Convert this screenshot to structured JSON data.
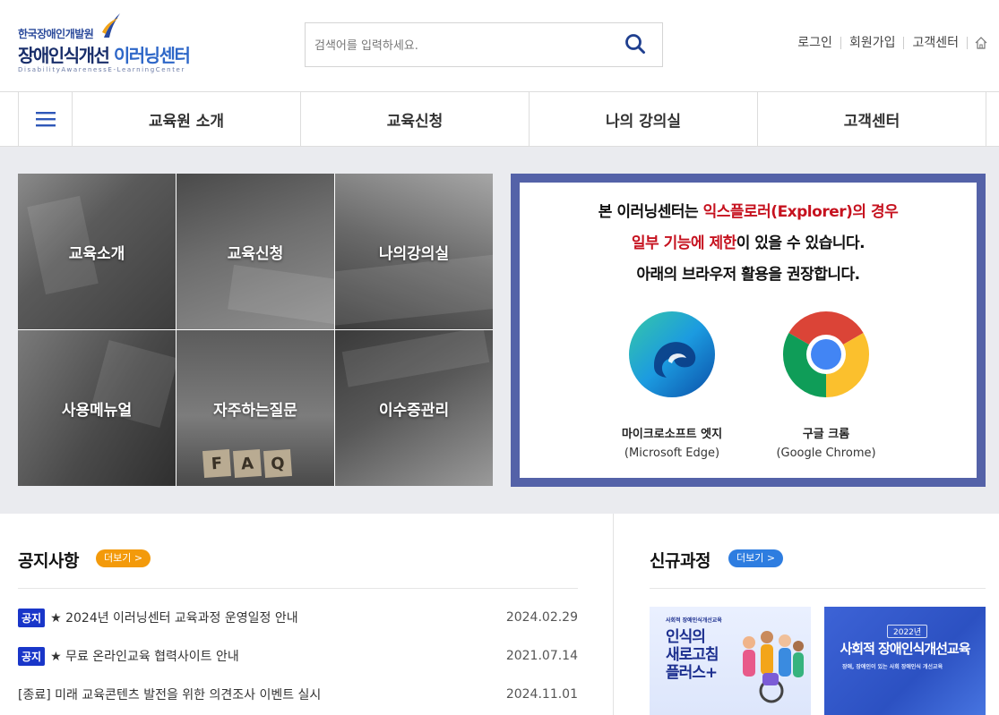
{
  "header": {
    "org_name": "한국장애인개발원",
    "site_name_part1": "장애인식개선 ",
    "site_name_part2": "이러닝센터",
    "site_name_eng": "DisabilityAwarenessE-LearningCenter",
    "search_placeholder": "검색어를 입력하세요.",
    "util_links": [
      "로그인",
      "회원가입",
      "고객센터"
    ],
    "accent_color": "#2e67c8"
  },
  "nav": {
    "menu_icon": "hamburger-menu-icon",
    "items": [
      "교육원 소개",
      "교육신청",
      "나의 강의실",
      "고객센터"
    ]
  },
  "tiles": [
    "교육소개",
    "교육신청",
    "나의강의실",
    "사용메뉴얼",
    "자주하는질문",
    "이수증관리"
  ],
  "faq_letters": [
    "F",
    "A",
    "Q"
  ],
  "browser_notice": {
    "line1_prefix": "본 이러닝센터는 ",
    "line1_red": "익스플로러(Explorer)의 경우",
    "line2_red": "일부 기능에 제한",
    "line2_suffix": "이 있을 수 있습니다.",
    "line3": "아래의 브라우저 활용을 권장합니다.",
    "browsers": [
      {
        "name": "마이크로소프트 엣지",
        "eng": "(Microsoft Edge)",
        "icon": "edge-icon"
      },
      {
        "name": "구글 크롬",
        "eng": "(Google Chrome)",
        "icon": "chrome-icon"
      }
    ],
    "border_color": "#5462a8",
    "highlight_color": "#c6121f"
  },
  "notices": {
    "title": "공지사항",
    "more_label": "더보기 >",
    "items": [
      {
        "badge": "공지",
        "title": "★ 2024년 이러닝센터 교육과정 운영일정 안내",
        "date": "2024.02.29"
      },
      {
        "badge": "공지",
        "title": "★ 무료 온라인교육 협력사이트 안내",
        "date": "2021.07.14"
      },
      {
        "badge": "",
        "title": "[종료] 미래 교육콘텐츠 발전을 위한 의견조사 이벤트 실시",
        "date": "2024.11.01"
      }
    ]
  },
  "courses": {
    "title": "신규과정",
    "more_label": "더보기 >",
    "cards": [
      {
        "caption": "사회적 장애인식개선교육",
        "title_l1": "인식의",
        "title_l2": "새로고침",
        "title_l3": "플러스+"
      },
      {
        "year": "2022년",
        "title": "사회적 장애인식개선교육",
        "caption": "장애, 장애인이 있는 사회 장애인식 개선교육"
      }
    ]
  }
}
